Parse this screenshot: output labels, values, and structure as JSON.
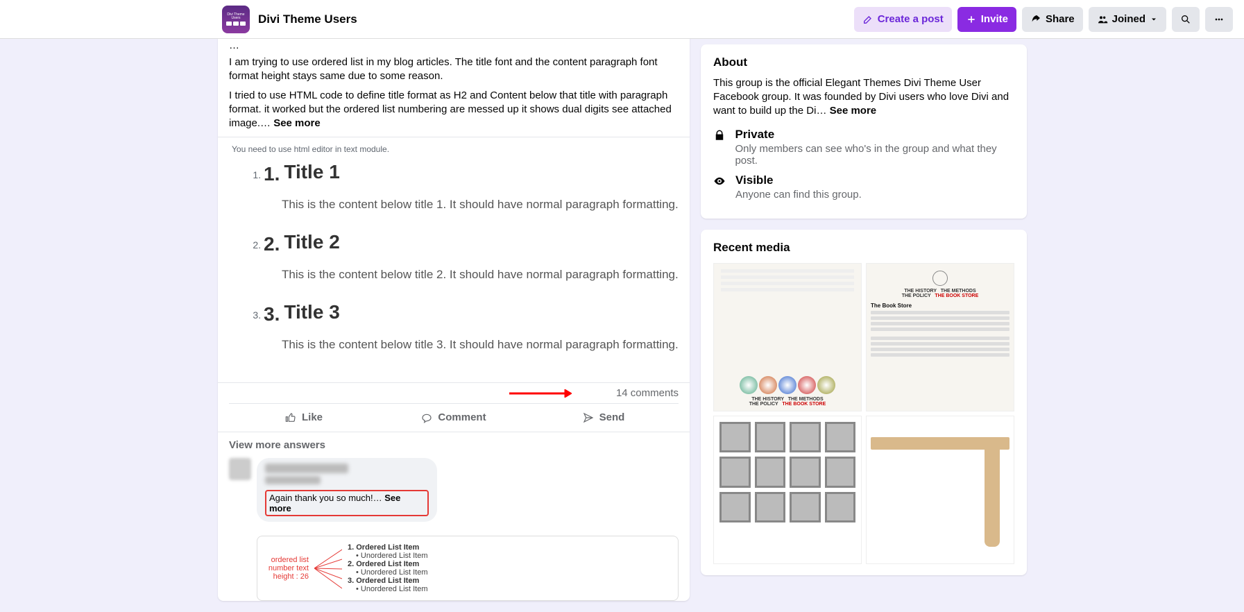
{
  "header": {
    "group_name": "Divi Theme Users",
    "create_post": "Create a post",
    "invite": "Invite",
    "share": "Share",
    "joined": "Joined"
  },
  "post": {
    "truncated_top": "...",
    "p1_prefix": "  I am trying to use ordered list in my blog articles. The title font and the content paragraph font format height stays same due to some reason.",
    "p2": "  I tried to use HTML code to define title format as H2 and Content below that title with paragraph format. it worked but the ordered list numbering are messed up it shows dual digits see attached image.",
    "truncated_ellipsis": "…",
    "see_more": "See more",
    "embedded_hint": "You need to use html editor in text module.",
    "items": [
      {
        "num": "1.",
        "title": "Title 1",
        "content": "This is the content below title 1. It should have normal paragraph formatting."
      },
      {
        "num": "2.",
        "title": "Title 2",
        "content": "This is the content below title 2. It should have normal paragraph formatting."
      },
      {
        "num": "3.",
        "title": "Title 3",
        "content": "This is the content below title 3. It should have normal paragraph formatting."
      }
    ],
    "comments_count": "14 comments",
    "like": "Like",
    "comment": "Comment",
    "send": "Send",
    "view_more": "View more answers",
    "reply_text": "Again thank you so much!… ",
    "reply_see_more": "See more",
    "attachment": {
      "label_line1": "ordered list",
      "label_line2": "number text",
      "label_line3": "height : 26",
      "rows": [
        {
          "num": "1.",
          "t": "Ordered List Item"
        },
        {
          "b": "• ",
          "t": "Unordered List Item"
        },
        {
          "num": "2.",
          "t": "Ordered List Item"
        },
        {
          "b": "• ",
          "t": "Unordered List Item"
        },
        {
          "num": "3.",
          "t": "Ordered List Item"
        },
        {
          "b": "• ",
          "t": "Unordered List Item"
        }
      ]
    }
  },
  "about": {
    "heading": "About",
    "desc_prefix": "This group is the official Elegant Themes Divi Theme User Facebook group. It was founded by Divi users who love Divi and want to build up the Di",
    "desc_ellipsis": "…",
    "see_more": "See more",
    "private_title": "Private",
    "private_sub": "Only members can see who's in the group and what they post.",
    "visible_title": "Visible",
    "visible_sub": "Anyone can find this group."
  },
  "media": {
    "heading": "Recent media"
  }
}
